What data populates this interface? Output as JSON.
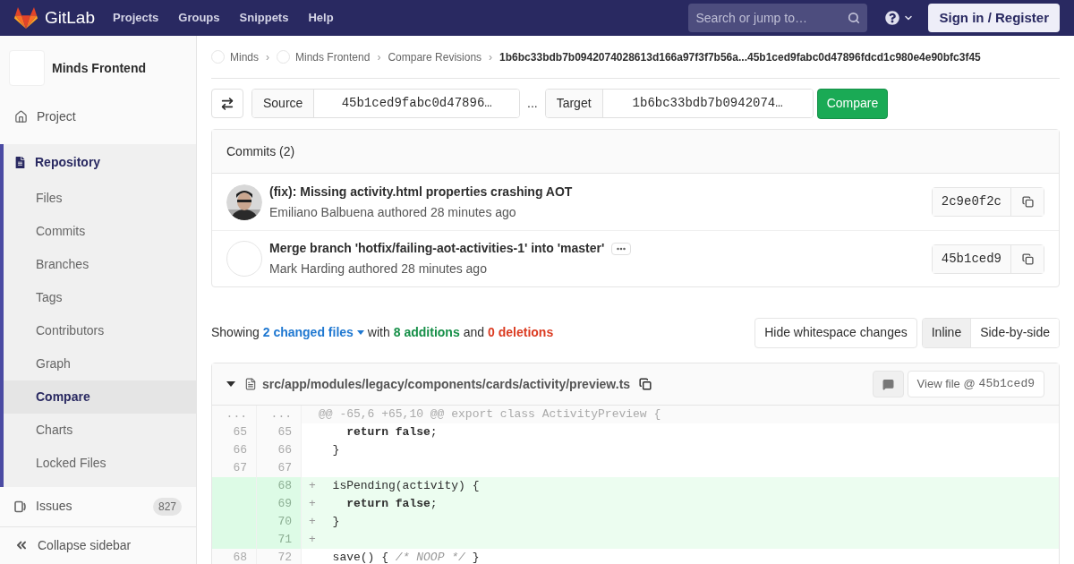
{
  "navbar": {
    "logo_text": "GitLab",
    "links": [
      "Projects",
      "Groups",
      "Snippets",
      "Help"
    ],
    "search": {
      "placeholder": "Search or jump to…"
    },
    "sign_in": "Sign in / Register"
  },
  "sidebar": {
    "project_name": "Minds Frontend",
    "items": [
      {
        "label": "Project",
        "kind": "project",
        "selected": false
      },
      {
        "label": "Repository",
        "kind": "repository",
        "selected": true,
        "children": [
          {
            "label": "Files",
            "selected": false
          },
          {
            "label": "Commits",
            "selected": false
          },
          {
            "label": "Branches",
            "selected": false
          },
          {
            "label": "Tags",
            "selected": false
          },
          {
            "label": "Contributors",
            "selected": false
          },
          {
            "label": "Graph",
            "selected": false
          },
          {
            "label": "Compare",
            "selected": true
          },
          {
            "label": "Charts",
            "selected": false
          },
          {
            "label": "Locked Files",
            "selected": false
          }
        ]
      },
      {
        "label": "Issues",
        "kind": "issues",
        "selected": false,
        "count": "827"
      }
    ],
    "collapse_label": "Collapse sidebar"
  },
  "breadcrumbs": [
    {
      "label": "Minds",
      "kind": "avatar"
    },
    {
      "separator": "›",
      "label": "Minds Frontend",
      "kind": "avatar"
    },
    {
      "separator": "›",
      "label": "Compare Revisions",
      "kind": "plain"
    },
    {
      "separator": "›",
      "label": "1b6bc33bdb7b0942074028613d166a97f3f7b56a...45b1ced9fabc0d47896fdcd1c980e4e90bfc3f45",
      "kind": "current"
    }
  ],
  "compare": {
    "source_label": "Source",
    "source_value": "45b1ced9fabc0d47896…",
    "separator": "...",
    "target_label": "Target",
    "target_value": "1b6bc33bdb7b0942074…",
    "button": "Compare"
  },
  "commits": {
    "title": "Commits (2)",
    "items": [
      {
        "title": "(fix): Missing activity.html properties crashing AOT",
        "author": "Emiliano Balbuena",
        "meta": "authored 28 minutes ago",
        "sha": "2c9e0f2c",
        "kind": "picture",
        "has_description": false
      },
      {
        "title": "Merge branch 'hotfix/failing-aot-activities-1' into 'master'",
        "author": "Mark Harding",
        "meta": "authored 28 minutes ago",
        "sha": "45b1ced9",
        "kind": "blank",
        "has_description": true
      }
    ]
  },
  "summary": {
    "showing": "Showing",
    "files": "2 changed files",
    "with": "with",
    "additions": "8 additions",
    "and": "and",
    "deletions": "0 deletions"
  },
  "view_options": {
    "whitespace": "Hide whitespace changes",
    "modes": [
      {
        "label": "Inline",
        "selected": true
      },
      {
        "label": "Side-by-side",
        "selected": false
      }
    ]
  },
  "diff_file": {
    "expanded": true,
    "path": "src/app/modules/legacy/components/cards/activity/preview.ts",
    "view_file": "View file @",
    "view_sha": "45b1ced9",
    "lines": [
      {
        "kind": "hunk",
        "old": "...",
        "new": "...",
        "tokens": [
          {
            "text": "@@ -65,6 +65,10 @@ export class ActivityPreview {",
            "kind": "plain"
          }
        ]
      },
      {
        "kind": "context",
        "old": "65",
        "new": "65",
        "tokens": [
          {
            "text": "    return false",
            "kind": "keyword"
          },
          {
            "text": ";",
            "kind": "plain"
          }
        ]
      },
      {
        "kind": "context",
        "old": "66",
        "new": "66",
        "tokens": [
          {
            "text": "  }",
            "kind": "plain"
          }
        ]
      },
      {
        "kind": "context",
        "old": "67",
        "new": "67"
      },
      {
        "kind": "add",
        "new": "68",
        "sign": "+",
        "tokens": [
          {
            "text": "  isPending(activity) {",
            "kind": "plain"
          }
        ]
      },
      {
        "kind": "add",
        "new": "69",
        "sign": "+",
        "tokens": [
          {
            "text": "    return false",
            "kind": "keyword"
          },
          {
            "text": ";",
            "kind": "plain"
          }
        ]
      },
      {
        "kind": "add",
        "new": "70",
        "sign": "+",
        "tokens": [
          {
            "text": "  }",
            "kind": "plain"
          }
        ]
      },
      {
        "kind": "add",
        "new": "71",
        "sign": "+"
      },
      {
        "kind": "context",
        "old": "68",
        "new": "72",
        "tokens": [
          {
            "text": "  save() { ",
            "kind": "plain"
          },
          {
            "text": "/* NOOP */",
            "kind": "comment"
          },
          {
            "text": " }",
            "kind": "plain"
          }
        ]
      }
    ]
  }
}
